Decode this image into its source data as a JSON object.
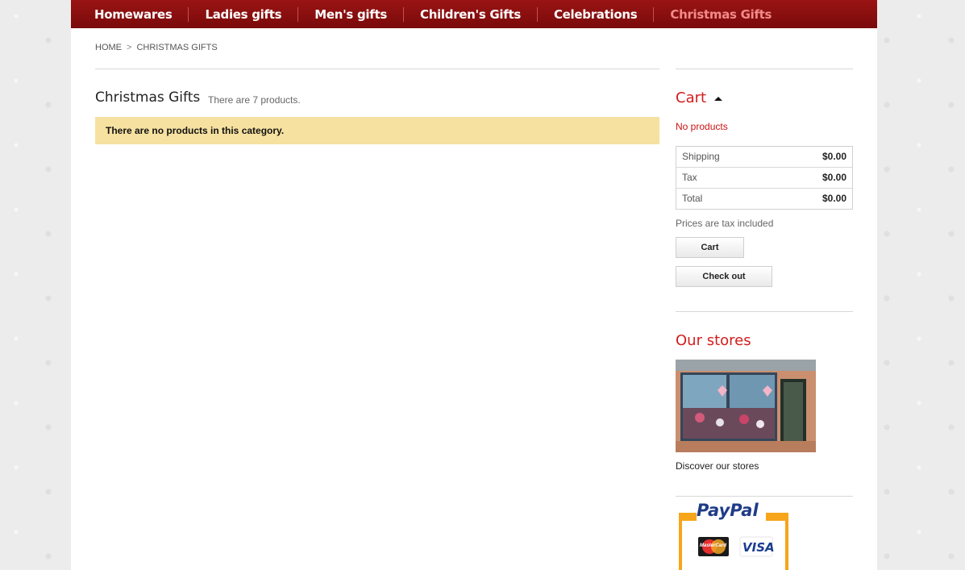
{
  "nav": {
    "items": [
      {
        "label": "Homewares"
      },
      {
        "label": "Ladies gifts"
      },
      {
        "label": "Men's gifts"
      },
      {
        "label": "Children's Gifts"
      },
      {
        "label": "Celebrations"
      },
      {
        "label": "Christmas Gifts",
        "active": true
      }
    ]
  },
  "breadcrumb": {
    "home": "Home",
    "separator": ">",
    "current": "Christmas Gifts"
  },
  "category": {
    "title": "Christmas Gifts",
    "count_text": "There are 7 products.",
    "warning": "There are no products in this category."
  },
  "cart": {
    "title": "Cart",
    "empty_text": "No products",
    "rows": [
      {
        "label": "Shipping",
        "value": "$0.00"
      },
      {
        "label": "Tax",
        "value": "$0.00"
      },
      {
        "label": "Total",
        "value": "$0.00"
      }
    ],
    "tax_note": "Prices are tax included",
    "cart_button": "Cart",
    "checkout_button": "Check out"
  },
  "stores": {
    "title": "Our stores",
    "link_text": "Discover our stores"
  },
  "paypal": {
    "logo_text": "PayPal",
    "card1": "MasterCard",
    "card2": "VISA"
  },
  "colors": {
    "nav_bg": "#8a0f0f",
    "accent_red": "#d31d1d",
    "active_nav": "#f38a8a",
    "warning_bg": "#f6e1a0"
  }
}
